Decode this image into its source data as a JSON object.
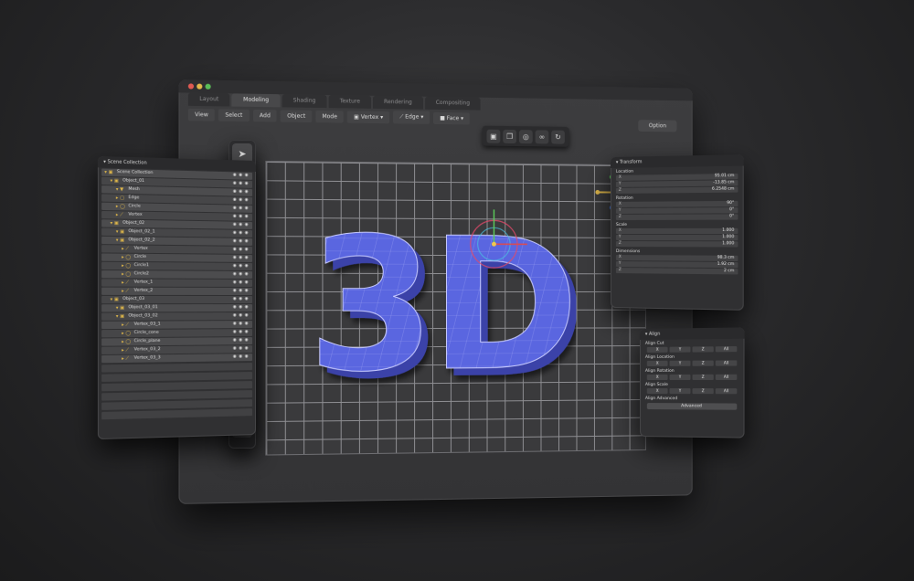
{
  "tabs": [
    {
      "label": "Layout",
      "active": false
    },
    {
      "label": "Modeling",
      "active": true
    },
    {
      "label": "Shading",
      "active": false
    },
    {
      "label": "Texture",
      "active": false
    },
    {
      "label": "Rendering",
      "active": false
    },
    {
      "label": "Compositing",
      "active": false
    }
  ],
  "menu": [
    "View",
    "Select",
    "Add",
    "Object",
    "Mode",
    "▣ Vertex ▾",
    "⟋ Edge ▾",
    "■ Face ▾"
  ],
  "option_label": "Option",
  "model_text": "3D",
  "colors": {
    "model_fill": "#5a66e0",
    "model_wire": "#c9ccff",
    "traffic_red": "#e05a52",
    "traffic_yellow": "#e2b94b",
    "traffic_green": "#5bbd58",
    "folder_icon": "#e0b84a"
  },
  "cluster_icons": [
    {
      "name": "frame-icon",
      "glyph": "▣"
    },
    {
      "name": "layers-icon",
      "glyph": "❐"
    },
    {
      "name": "target-icon",
      "glyph": "◎"
    },
    {
      "name": "link-icon",
      "glyph": "∞"
    },
    {
      "name": "refresh-icon",
      "glyph": "↻"
    }
  ],
  "toolbar_icons": [
    {
      "name": "select-cursor-icon",
      "glyph": "➤"
    },
    {
      "name": "zoom-icon",
      "glyph": "⚲"
    },
    {
      "name": "move-icon",
      "glyph": "✥"
    },
    {
      "name": "rotate-icon",
      "glyph": "↻"
    },
    {
      "name": "scale-icon",
      "glyph": "⤡"
    },
    {
      "name": "transform-icon",
      "glyph": "⊘"
    },
    {
      "name": "annotate-icon",
      "glyph": "⚓"
    },
    {
      "name": "measure-icon",
      "glyph": "⟋"
    },
    {
      "name": "add-cube-icon",
      "glyph": "⊠"
    },
    {
      "name": "extrude-icon",
      "glyph": "⊘"
    },
    {
      "name": "knife-icon",
      "glyph": "⤢"
    },
    {
      "name": "inset-icon",
      "glyph": "▣"
    },
    {
      "name": "bevel-icon",
      "glyph": "⧉"
    }
  ],
  "scene_panel": {
    "title": "▾ Scene Collection",
    "rows": [
      {
        "label": "Scene Collection",
        "indent": 0,
        "icon": "▾ ▣"
      },
      {
        "label": "Object_01",
        "indent": 1,
        "icon": "▾ ▣"
      },
      {
        "label": "Mesh",
        "indent": 2,
        "icon": "▾ ▼"
      },
      {
        "label": "Edge",
        "indent": 2,
        "icon": "▸ ▢"
      },
      {
        "label": "Circle",
        "indent": 2,
        "icon": "▸ ◯"
      },
      {
        "label": "Vertex",
        "indent": 2,
        "icon": "▸ ⟋"
      },
      {
        "label": "Object_02",
        "indent": 1,
        "icon": "▾ ▣"
      },
      {
        "label": "Object_02_1",
        "indent": 2,
        "icon": "▾ ▣"
      },
      {
        "label": "Object_02_2",
        "indent": 2,
        "icon": "▾ ▣"
      },
      {
        "label": "Vertex",
        "indent": 3,
        "icon": "▸ ⟋"
      },
      {
        "label": "Circle",
        "indent": 3,
        "icon": "▸ ◯"
      },
      {
        "label": "Circle1",
        "indent": 3,
        "icon": "▸ ◯"
      },
      {
        "label": "Circle2",
        "indent": 3,
        "icon": "▸ ◯"
      },
      {
        "label": "Vertex_1",
        "indent": 3,
        "icon": "▸ ⟋"
      },
      {
        "label": "Vertex_2",
        "indent": 3,
        "icon": "▸ ⟋"
      },
      {
        "label": "Object_03",
        "indent": 1,
        "icon": "▾ ▣"
      },
      {
        "label": "Object_03_01",
        "indent": 2,
        "icon": "▾ ▣"
      },
      {
        "label": "Object_03_02",
        "indent": 2,
        "icon": "▾ ▣"
      },
      {
        "label": "Vertex_03_1",
        "indent": 3,
        "icon": "▸ ⟋"
      },
      {
        "label": "Circle_cone",
        "indent": 3,
        "icon": "▸ ◯"
      },
      {
        "label": "Circle_plane",
        "indent": 3,
        "icon": "▸ ◯"
      },
      {
        "label": "Vertex_03_2",
        "indent": 3,
        "icon": "▸ ⟋"
      },
      {
        "label": "Vertex_03_3",
        "indent": 3,
        "icon": "▸ ⟋"
      }
    ],
    "row_controls": "◉ ◉ ◉",
    "empty_rows": 6
  },
  "transform_panel": {
    "title": "▾ Transform",
    "sections": [
      {
        "label": "Location",
        "fields": [
          {
            "axis": "X",
            "value": "95.01 cm"
          },
          {
            "axis": "Y",
            "value": "-13.85 cm"
          },
          {
            "axis": "Z",
            "value": "6.2548 cm"
          }
        ]
      },
      {
        "label": "Rotation",
        "fields": [
          {
            "axis": "X",
            "value": "90°"
          },
          {
            "axis": "Y",
            "value": "0°"
          },
          {
            "axis": "Z",
            "value": "0°"
          }
        ]
      },
      {
        "label": "Scale",
        "fields": [
          {
            "axis": "X",
            "value": "1.000"
          },
          {
            "axis": "Y",
            "value": "1.000"
          },
          {
            "axis": "Z",
            "value": "1.000"
          }
        ]
      },
      {
        "label": "Dimensions",
        "fields": [
          {
            "axis": "X",
            "value": "98.3 cm"
          },
          {
            "axis": "Y",
            "value": "1.92 cm"
          },
          {
            "axis": "Z",
            "value": "2 cm"
          }
        ]
      }
    ]
  },
  "align_panel": {
    "title": "▾ Align",
    "sections": [
      {
        "label": "Align Cut",
        "cells": [
          "X",
          "Y",
          "Z",
          "All"
        ]
      },
      {
        "label": "Align Location",
        "cells": [
          "X",
          "Y",
          "Z",
          "All"
        ]
      },
      {
        "label": "Align Rotation",
        "cells": [
          "X",
          "Y",
          "Z",
          "All"
        ]
      },
      {
        "label": "Align Scale",
        "cells": [
          "X",
          "Y",
          "Z",
          "All"
        ]
      }
    ],
    "advanced_label": "Align Advanced",
    "advanced_button": "Advanced"
  }
}
